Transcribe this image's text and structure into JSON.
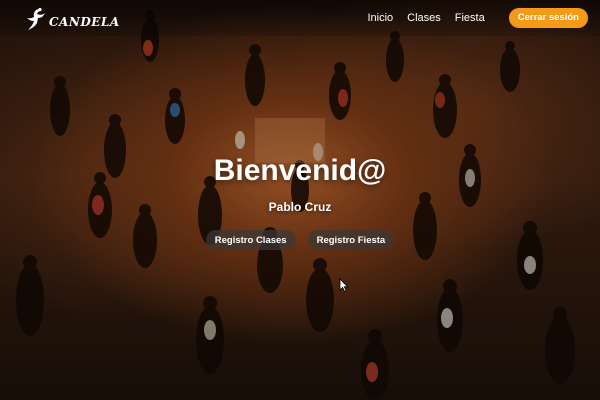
{
  "brand": {
    "name": "Candela",
    "logo_text": "CANDELA"
  },
  "nav": {
    "links": [
      {
        "label": "Inicio"
      },
      {
        "label": "Clases"
      },
      {
        "label": "Fiesta"
      }
    ],
    "logout_label": "Cerrar sesión"
  },
  "hero": {
    "title": "Bienvenid@",
    "user_name": "Pablo Cruz",
    "actions": [
      {
        "label": "Registro Clases"
      },
      {
        "label": "Registro Fiesta"
      }
    ]
  },
  "colors": {
    "accent": "#f59a16",
    "secondary_button": "#4a4444",
    "text": "#ffffff"
  }
}
